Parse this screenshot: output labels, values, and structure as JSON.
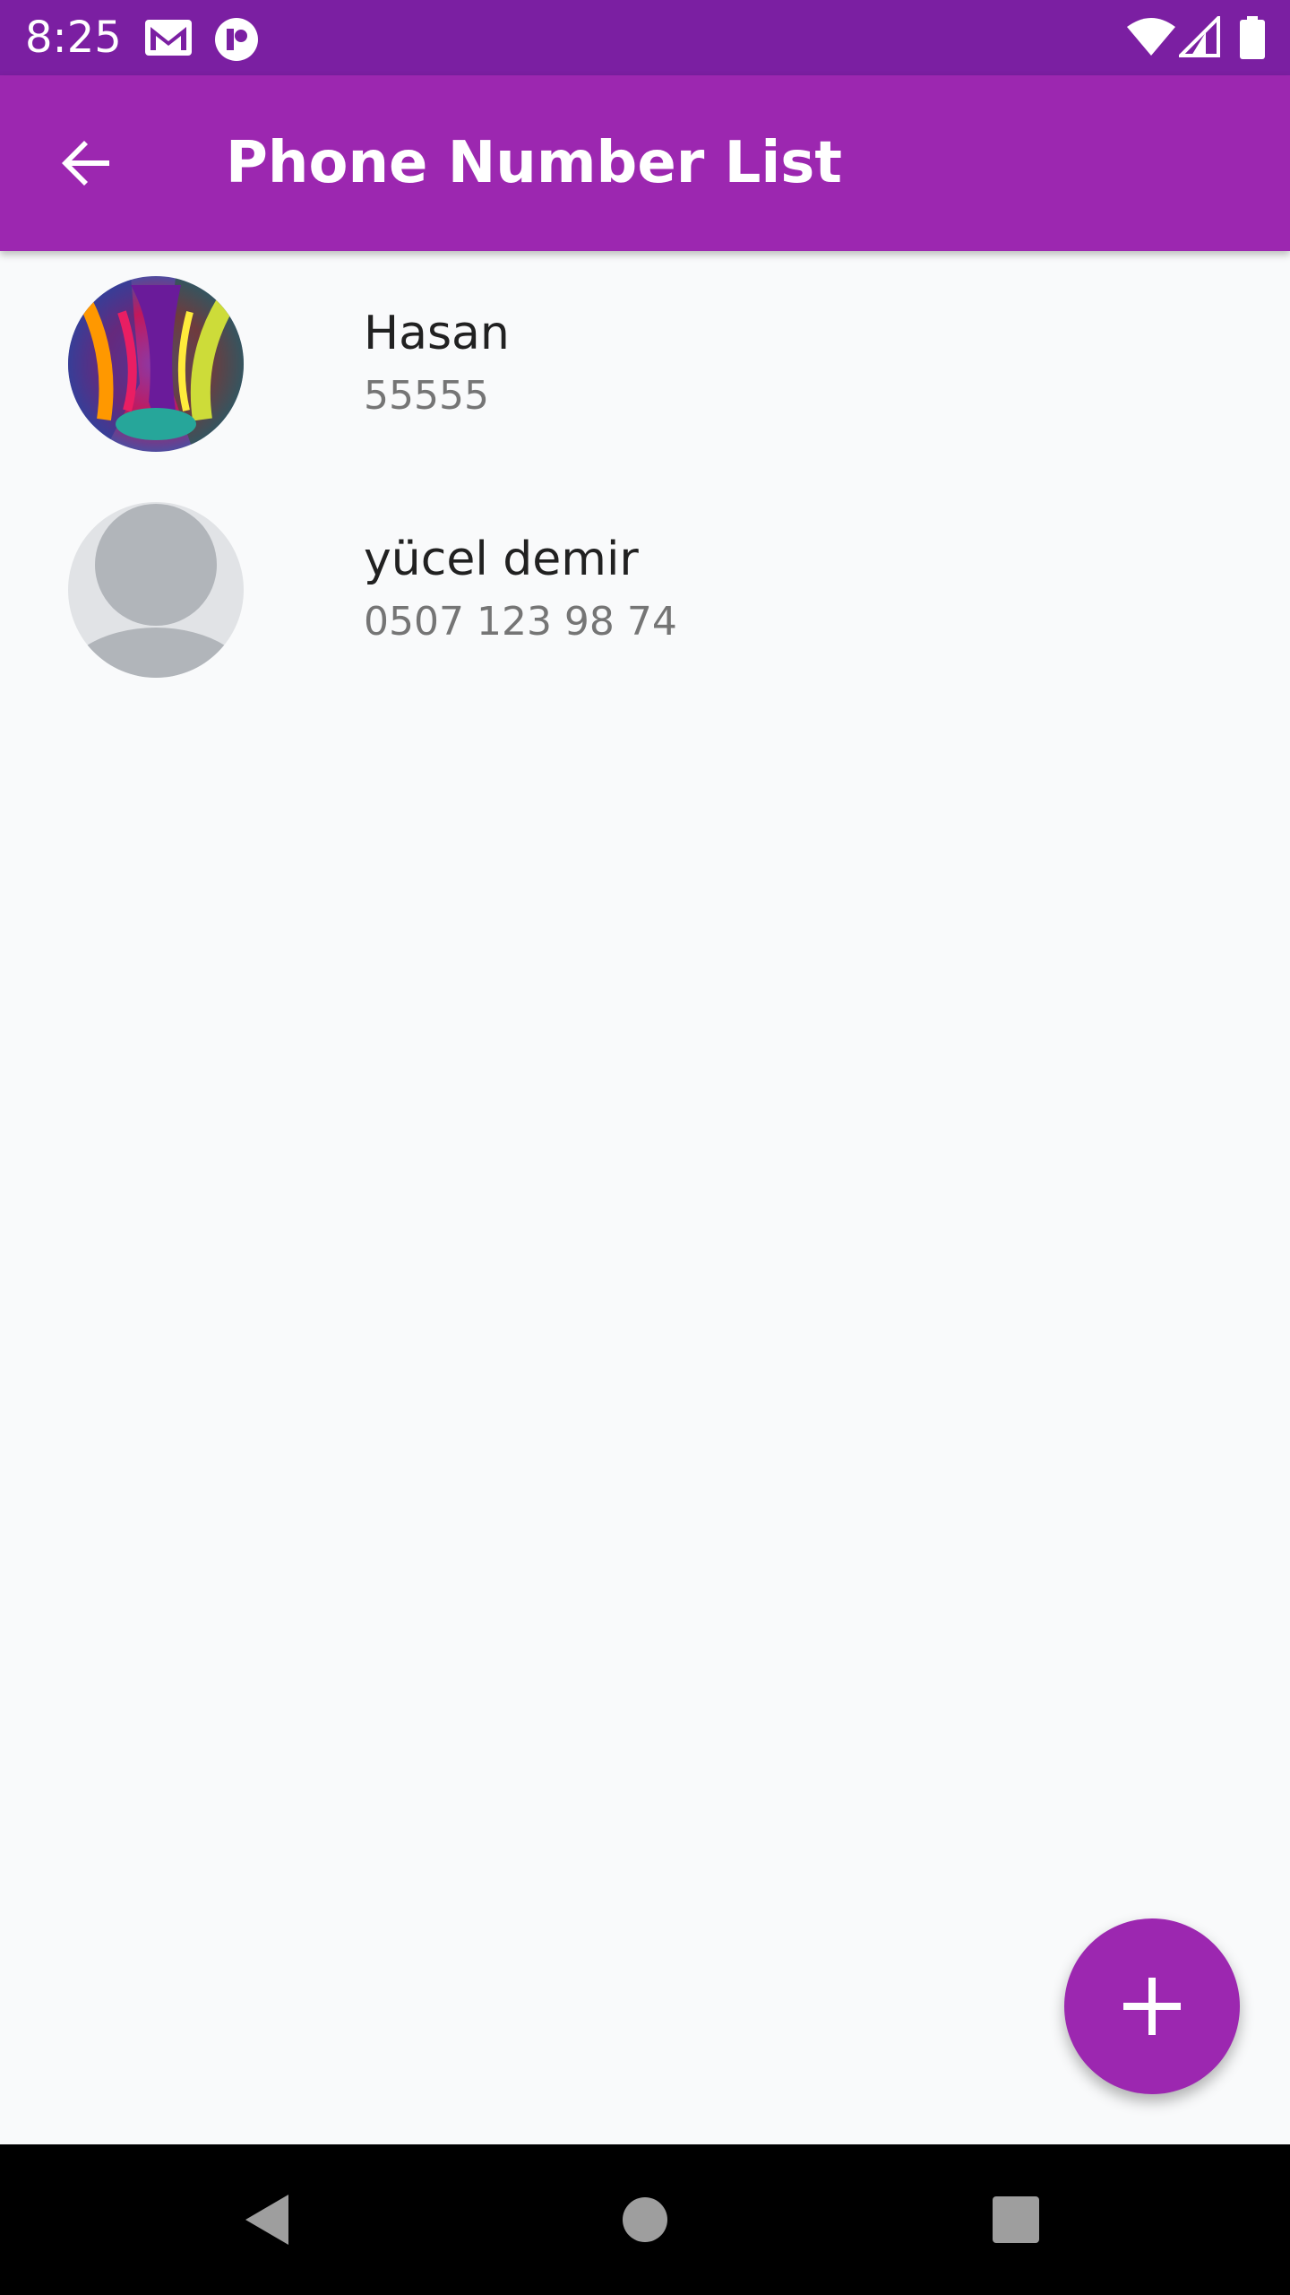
{
  "status_bar": {
    "time": "8:25",
    "icons": [
      "gmail-icon",
      "app-notification-icon",
      "wifi-icon",
      "signal-icon",
      "battery-icon"
    ]
  },
  "app_bar": {
    "title": "Phone Number List",
    "back_icon": "arrow-back-icon"
  },
  "contacts": [
    {
      "name": "Hasan",
      "phone": "55555",
      "avatar": "photo"
    },
    {
      "name": "yücel demir",
      "phone": "0507 123 98 74",
      "avatar": "default-person"
    }
  ],
  "fab": {
    "icon": "plus-icon"
  },
  "nav_bar": {
    "buttons": [
      "back-triangle-icon",
      "home-circle-icon",
      "recents-square-icon"
    ]
  },
  "colors": {
    "primary": "#9c27b0",
    "primary_dark": "#7b1fa2",
    "background": "#f9fafb",
    "name_text": "#212121",
    "phone_text": "#757575"
  }
}
